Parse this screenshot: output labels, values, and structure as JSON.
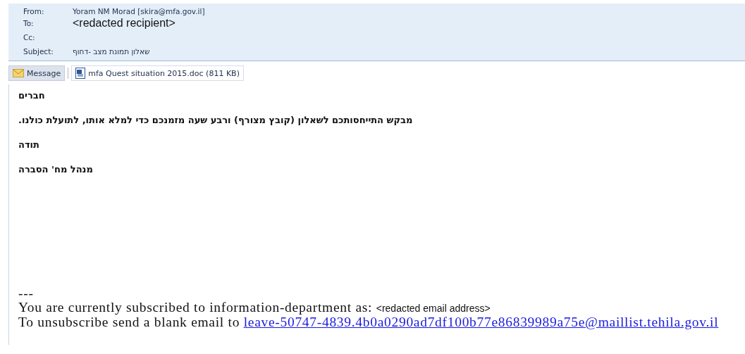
{
  "header": {
    "fields": [
      {
        "label": "From:",
        "value": "Yoram NM Morad [skira@mfa.gov.il]",
        "kind": "plain"
      },
      {
        "label": "To:",
        "value": "<redacted recipient>",
        "kind": "large"
      },
      {
        "label": "Cc:"
      },
      {
        "label": "Subject:",
        "value": "שאלון תמונת מצב -דחוף",
        "kind": "plain"
      }
    ]
  },
  "tabs": [
    {
      "label": "Message",
      "kind": "message",
      "selected": true
    },
    {
      "label": "mfa Quest situation 2015.doc (811 KB)",
      "kind": "attachment",
      "selected": false
    }
  ],
  "body": {
    "paragraphs": [
      "חברים",
      "מבקש התייחסותכם לשאלון (קובץ מצורף) ורבע שעה מזמנכם כדי למלא אותו, לתועלת כולנו.",
      "תודה",
      "מנהל מח' הסברה"
    ],
    "separator": "---",
    "footer": {
      "subscribed_text": "You are currently subscribed to information-department as:",
      "redacted_address": "<redacted email address>",
      "unsubscribe_text": "To unsubscribe send a blank email to",
      "unsubscribe_link": "leave-50747-4839.4b0a0290ad7df100b77e86839989a75e@maillist.tehila.gov.il"
    }
  }
}
